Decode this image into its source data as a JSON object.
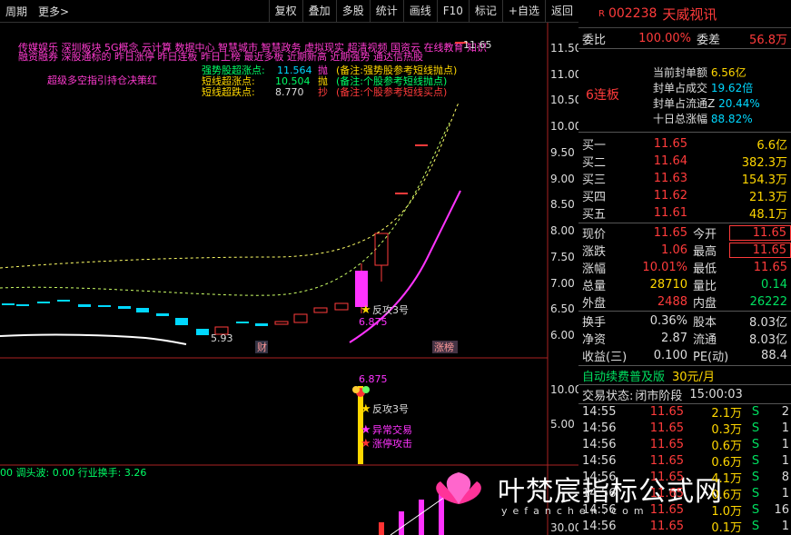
{
  "toolbar": {
    "left": [
      "周期",
      "更多>"
    ],
    "buttons": [
      "复权",
      "叠加",
      "多股",
      "统计",
      "画线",
      "F10",
      "标记",
      "+自选",
      "返回"
    ]
  },
  "stock": {
    "code": "002238",
    "name": "天威视讯",
    "r": "R"
  },
  "weibi": {
    "label": "委比",
    "value": "100.00%",
    "label2": "委差",
    "value2": "56.8万"
  },
  "limit_stats": {
    "badge": "6连板",
    "rows": [
      {
        "label": "当前封单额",
        "value": "6.56亿"
      },
      {
        "label": "封单占成交",
        "value": "19.62倍"
      },
      {
        "label": "封单占流通Z",
        "value": "20.44%"
      },
      {
        "label": "十日总涨幅",
        "value": "88.82%"
      }
    ]
  },
  "bids": [
    {
      "label": "买一",
      "price": "11.65",
      "vol": "6.6亿"
    },
    {
      "label": "买二",
      "price": "11.64",
      "vol": "382.3万"
    },
    {
      "label": "买三",
      "price": "11.63",
      "vol": "154.3万"
    },
    {
      "label": "买四",
      "price": "11.62",
      "vol": "21.3万"
    },
    {
      "label": "买五",
      "price": "11.61",
      "vol": "48.1万"
    }
  ],
  "quote": [
    {
      "l1": "现价",
      "v1": "11.65",
      "l2": "今开",
      "v2": "11.65",
      "c1": "red",
      "c2": "red",
      "box2": true
    },
    {
      "l1": "涨跌",
      "v1": "1.06",
      "l2": "最高",
      "v2": "11.65",
      "c1": "red",
      "c2": "red",
      "box2": true
    },
    {
      "l1": "涨幅",
      "v1": "10.01%",
      "l2": "最低",
      "v2": "11.65",
      "c1": "red",
      "c2": "red",
      "box2": false
    },
    {
      "l1": "总量",
      "v1": "28710",
      "l2": "量比",
      "v2": "0.14",
      "c1": "yel",
      "c2": "grn",
      "box2": false
    },
    {
      "l1": "外盘",
      "v1": "2488",
      "l2": "内盘",
      "v2": "26222",
      "c1": "red",
      "c2": "grn",
      "box2": false
    }
  ],
  "info": [
    {
      "l1": "换手",
      "v1": "0.36%",
      "l2": "股本",
      "v2": "8.03亿"
    },
    {
      "l1": "净资",
      "v1": "2.87",
      "l2": "流通",
      "v2": "8.03亿"
    },
    {
      "l1": "收益(三)",
      "v1": "0.100",
      "l2": "PE(动)",
      "v2": "88.4"
    }
  ],
  "promo": {
    "text": "自动续费普及版",
    "price": "30元/月"
  },
  "trade_status": {
    "label": "交易状态:",
    "value": "闭市阶段",
    "time": "15:00:03"
  },
  "ticks": [
    {
      "time": "14:55",
      "price": "11.65",
      "vol": "2.1万",
      "side": "S",
      "n": "2"
    },
    {
      "time": "14:56",
      "price": "11.65",
      "vol": "0.3万",
      "side": "S",
      "n": "1"
    },
    {
      "time": "14:56",
      "price": "11.65",
      "vol": "0.6万",
      "side": "S",
      "n": "1"
    },
    {
      "time": "14:56",
      "price": "11.65",
      "vol": "0.6万",
      "side": "S",
      "n": "1"
    },
    {
      "time": "14:56",
      "price": "11.65",
      "vol": "4.1万",
      "side": "S",
      "n": "8"
    },
    {
      "time": "14:56",
      "price": "11.65",
      "vol": "0.6万",
      "side": "S",
      "n": "1"
    },
    {
      "time": "14:56",
      "price": "11.65",
      "vol": "1.0万",
      "side": "S",
      "n": "16"
    },
    {
      "time": "14:56",
      "price": "11.65",
      "vol": "0.1万",
      "side": "S",
      "n": "1"
    }
  ],
  "chart": {
    "concepts_line1": "传媒娱乐 深圳板块 5G概念 云计算 数据中心 智慧城市 智慧政务 虚拟现实 超清视频 国资云 在线教育 知识",
    "concepts_line2": "融资融券 深股通标的 昨日涨停 昨日连板 昨日上榜 最近多板 近期新高 近期强势 通达信热股",
    "ind_rows": [
      {
        "name": "强势股超涨点:",
        "val": "11.564",
        "act": "抛",
        "note": "(备注:强势股参考短线抛点)",
        "color": "#ffd700"
      },
      {
        "name": "短线超涨点:",
        "val": "10.504",
        "act": "抛",
        "note": "(备注:个股参考短线抛点)",
        "color": "#00ff66"
      },
      {
        "name": "短线超跌点:",
        "val": "8.770",
        "act": "抄",
        "note": "(备注:个股参考短线买点)",
        "color": "#ff3b3b"
      }
    ],
    "left_label": "超级多空指引持仓决策红",
    "price_ticks": [
      "11.50",
      "11.00",
      "10.50",
      "10.00",
      "9.50",
      "9.00",
      "8.50",
      "8.00",
      "7.50",
      "7.00",
      "6.50",
      "6.00"
    ],
    "low_label": "5.93",
    "high_label": "11.65",
    "fangong": "反攻3号",
    "fangong_val": "6.875",
    "cai": "财",
    "zhangbang": "涨榜",
    "lower_ticks": [
      "10.00",
      "5.00"
    ],
    "lower_val": "6.875",
    "lower_labels": [
      "反攻3号",
      "异常交易",
      "涨停攻击"
    ],
    "bottom_status": "00 调头波: 0.00 行业换手: 3.26",
    "vol_ticks": [
      "30.00"
    ]
  },
  "watermark": {
    "main": "叶梵宸指标公式网",
    "sub": "yefanchen.com"
  }
}
